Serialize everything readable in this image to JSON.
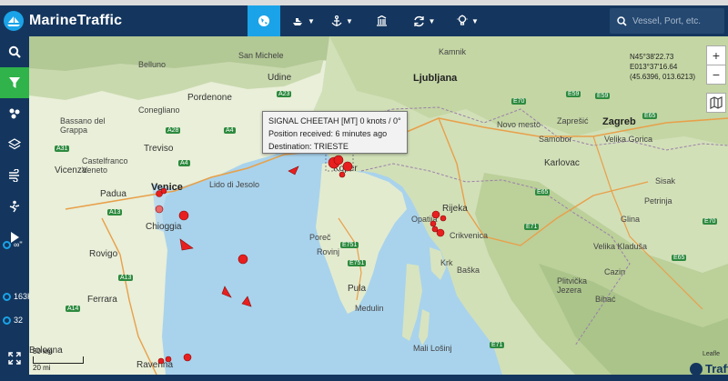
{
  "app": {
    "name": "MarineTraffic"
  },
  "nav": {
    "items": [
      {
        "icon": "globe-icon",
        "active": true
      },
      {
        "icon": "ship-icon"
      },
      {
        "icon": "anchor-icon"
      },
      {
        "icon": "building-icon"
      },
      {
        "icon": "sync-icon"
      },
      {
        "icon": "bulb-icon"
      }
    ]
  },
  "search": {
    "placeholder": "Vessel, Port, etc."
  },
  "sidebar": {
    "buttons": [
      "search-icon",
      "filter-icon",
      "clusters-icon",
      "layers-icon",
      "weather-icon",
      "routes-icon",
      "play-icon"
    ],
    "stats": [
      {
        "label": "∞\"",
        "icon": "sync-icon"
      },
      {
        "label": "163K",
        "icon": "vessels-icon"
      },
      {
        "label": "32",
        "icon": "gear-icon"
      }
    ]
  },
  "coordinates": {
    "lat": "N45°38'22.73",
    "lon": "E013°37'16.64",
    "decimal": "(45.6396, 013.6213)"
  },
  "tooltip": {
    "line1": "SIGNAL CHEETAH [MT] 0 knots / 0°",
    "line2": "Position received: 6 minutes ago",
    "line3": "Destination: TRIESTE"
  },
  "map": {
    "places": [
      {
        "id": "ljubljana",
        "name": "Ljubljana",
        "cls": "big"
      },
      {
        "id": "zagreb",
        "name": "Zagreb",
        "cls": "big"
      },
      {
        "id": "venice",
        "name": "Venice",
        "cls": "big"
      },
      {
        "id": "udine",
        "name": "Udine",
        "cls": "mid"
      },
      {
        "id": "belluno",
        "name": "Belluno",
        "cls": ""
      },
      {
        "id": "pordenone",
        "name": "Pordenone",
        "cls": "mid"
      },
      {
        "id": "conegliano",
        "name": "Conegliano",
        "cls": ""
      },
      {
        "id": "treviso",
        "name": "Treviso",
        "cls": "mid"
      },
      {
        "id": "castelfranco",
        "name": "Castelfranco Veneto",
        "cls": ""
      },
      {
        "id": "bassano",
        "name": "Bassano del Grappa",
        "cls": ""
      },
      {
        "id": "vicenza",
        "name": "Vicenza",
        "cls": "mid"
      },
      {
        "id": "padua",
        "name": "Padua",
        "cls": "mid"
      },
      {
        "id": "chioggia",
        "name": "Chioggia",
        "cls": "mid"
      },
      {
        "id": "rovigo",
        "name": "Rovigo",
        "cls": "mid"
      },
      {
        "id": "ferrara",
        "name": "Ferrara",
        "cls": "mid"
      },
      {
        "id": "ravenna",
        "name": "Ravenna",
        "cls": "mid"
      },
      {
        "id": "bologna",
        "name": "Bologna",
        "cls": "mid"
      },
      {
        "id": "jesolo",
        "name": "Lido di Jesolo",
        "cls": ""
      },
      {
        "id": "koper",
        "name": "Koper",
        "cls": "mid"
      },
      {
        "id": "porec",
        "name": "Poreč",
        "cls": ""
      },
      {
        "id": "rovinj",
        "name": "Rovinj",
        "cls": ""
      },
      {
        "id": "pula",
        "name": "Pula",
        "cls": "mid"
      },
      {
        "id": "medulin",
        "name": "Medulin",
        "cls": ""
      },
      {
        "id": "rijeka",
        "name": "Rijeka",
        "cls": "mid"
      },
      {
        "id": "opatija",
        "name": "Opatija",
        "cls": ""
      },
      {
        "id": "crikvenica",
        "name": "Crikvenica",
        "cls": ""
      },
      {
        "id": "krk",
        "name": "Krk",
        "cls": ""
      },
      {
        "id": "baska",
        "name": "Baška",
        "cls": ""
      },
      {
        "id": "losinj",
        "name": "Mali Lošinj",
        "cls": ""
      },
      {
        "id": "kamnik",
        "name": "Kamnik",
        "cls": ""
      },
      {
        "id": "novomesto",
        "name": "Novo mesto",
        "cls": ""
      },
      {
        "id": "zapresic",
        "name": "Zaprešić",
        "cls": ""
      },
      {
        "id": "samobor",
        "name": "Samobor",
        "cls": ""
      },
      {
        "id": "velika",
        "name": "Velika Gorica",
        "cls": ""
      },
      {
        "id": "karlovac",
        "name": "Karlovac",
        "cls": "mid"
      },
      {
        "id": "sisak",
        "name": "Sisak",
        "cls": ""
      },
      {
        "id": "petrinja",
        "name": "Petrinja",
        "cls": ""
      },
      {
        "id": "kladusa",
        "name": "Velika Kladuša",
        "cls": ""
      },
      {
        "id": "cazin",
        "name": "Cazin",
        "cls": ""
      },
      {
        "id": "bihac",
        "name": "Bihać",
        "cls": ""
      },
      {
        "id": "plitvice",
        "name": "Plitvička Jezera",
        "cls": ""
      },
      {
        "id": "glina",
        "name": "Glina",
        "cls": ""
      },
      {
        "id": "sanmichele",
        "name": "San Michele",
        "cls": ""
      }
    ],
    "shields": [
      {
        "id": "s1",
        "label": "A4",
        "blue": false
      },
      {
        "id": "s2",
        "label": "A23",
        "blue": false
      },
      {
        "id": "s3",
        "label": "A28",
        "blue": false
      },
      {
        "id": "s4",
        "label": "A31",
        "blue": false
      },
      {
        "id": "s5",
        "label": "A13",
        "blue": false
      },
      {
        "id": "s6",
        "label": "A13",
        "blue": false
      },
      {
        "id": "s7",
        "label": "A4",
        "blue": false
      },
      {
        "id": "s8",
        "label": "A14",
        "blue": false
      },
      {
        "id": "s9",
        "label": "E751",
        "blue": false
      },
      {
        "id": "s10",
        "label": "E751",
        "blue": false
      },
      {
        "id": "s11",
        "label": "E59",
        "blue": false
      },
      {
        "id": "s12",
        "label": "E65",
        "blue": false
      },
      {
        "id": "s13",
        "label": "E70",
        "blue": false
      },
      {
        "id": "s14",
        "label": "E71",
        "blue": false
      },
      {
        "id": "s15",
        "label": "E65",
        "blue": false
      },
      {
        "id": "s16",
        "label": "E65",
        "blue": false
      },
      {
        "id": "s17",
        "label": "E71",
        "blue": false
      },
      {
        "id": "s18",
        "label": "E70",
        "blue": false
      },
      {
        "id": "s19",
        "label": "E59",
        "blue": false
      }
    ]
  },
  "scale": {
    "km": "50 km",
    "mi": "20 mi"
  },
  "map_controls": {
    "zoom_in": "+",
    "zoom_out": "−"
  },
  "watermark": "Traffic",
  "attribution": "Leafle",
  "colors": {
    "navbar": "#14365e",
    "accent": "#1aa3e8",
    "active_filter": "#2fb34a",
    "vessel": "#e81f1f",
    "sea": "#a9d3ec"
  }
}
